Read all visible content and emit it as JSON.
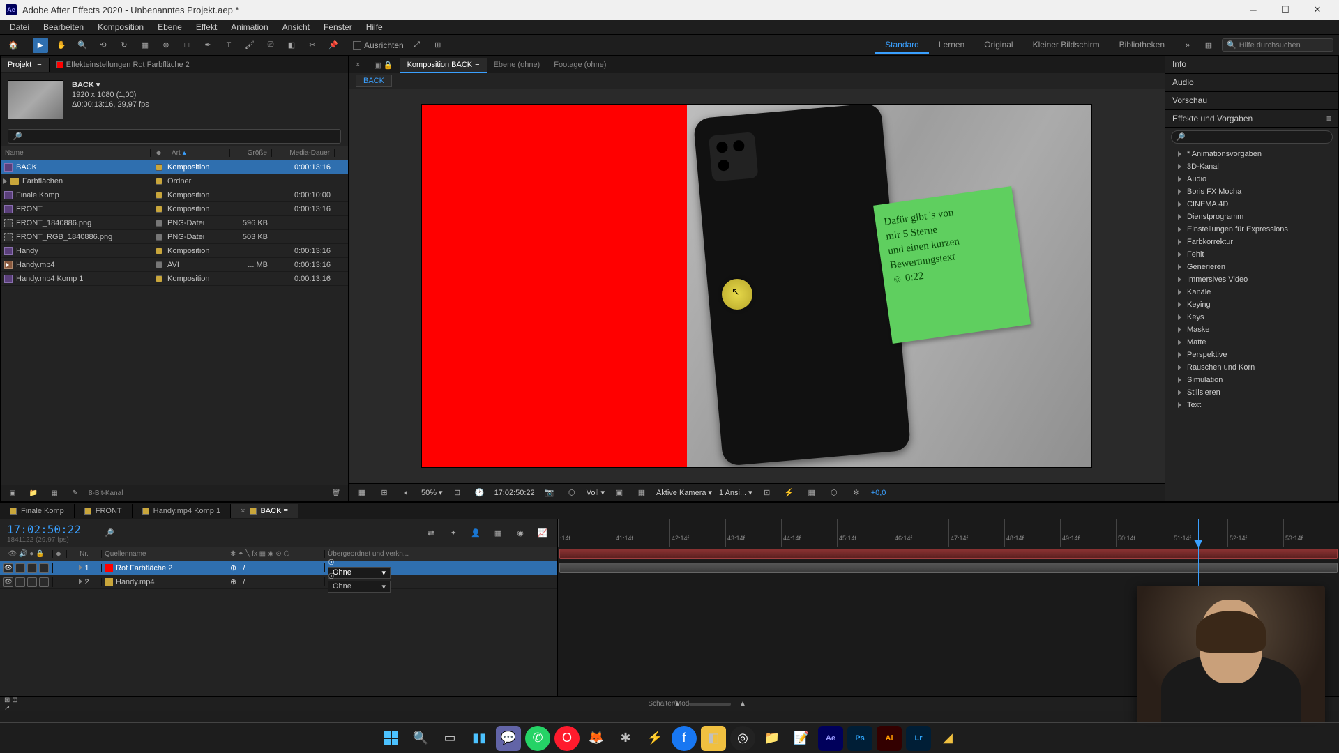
{
  "app": {
    "title": "Adobe After Effects 2020 - Unbenanntes Projekt.aep *"
  },
  "menu": [
    "Datei",
    "Bearbeiten",
    "Komposition",
    "Ebene",
    "Effekt",
    "Animation",
    "Ansicht",
    "Fenster",
    "Hilfe"
  ],
  "toolbar": {
    "align_label": "Ausrichten",
    "workspaces": [
      "Standard",
      "Lernen",
      "Original",
      "Kleiner Bildschirm",
      "Bibliotheken"
    ],
    "active_workspace": "Standard",
    "search_placeholder": "Hilfe durchsuchen"
  },
  "project": {
    "tab_project": "Projekt",
    "tab_effect": "Effekteinstellungen Rot Farbfläche 2",
    "preview_name": "BACK",
    "preview_dims": "1920 x 1080 (1,00)",
    "preview_dur": "Δ0:00:13:16, 29,97 fps",
    "headers": {
      "name": "Name",
      "label": "",
      "art": "Art",
      "size": "Größe",
      "dur": "Media-Dauer"
    },
    "rows": [
      {
        "name": "BACK",
        "icon": "comp",
        "label": "#c9a63b",
        "art": "Komposition",
        "size": "",
        "dur": "0:00:13:16",
        "selected": true
      },
      {
        "name": "Farbflächen",
        "icon": "folder",
        "label": "#c9a63b",
        "art": "Ordner",
        "size": "",
        "dur": "",
        "reveal": true
      },
      {
        "name": "Finale Komp",
        "icon": "comp",
        "label": "#c9a63b",
        "art": "Komposition",
        "size": "",
        "dur": "0:00:10:00"
      },
      {
        "name": "FRONT",
        "icon": "comp",
        "label": "#c9a63b",
        "art": "Komposition",
        "size": "",
        "dur": "0:00:13:16"
      },
      {
        "name": "FRONT_1840886.png",
        "icon": "png",
        "label": "#777",
        "art": "PNG-Datei",
        "size": "596 KB",
        "dur": ""
      },
      {
        "name": "FRONT_RGB_1840886.png",
        "icon": "png",
        "label": "#777",
        "art": "PNG-Datei",
        "size": "503 KB",
        "dur": ""
      },
      {
        "name": "Handy",
        "icon": "comp",
        "label": "#c9a63b",
        "art": "Komposition",
        "size": "",
        "dur": "0:00:13:16"
      },
      {
        "name": "Handy.mp4",
        "icon": "avi",
        "label": "#777",
        "art": "AVI",
        "size": "... MB",
        "dur": "0:00:13:16"
      },
      {
        "name": "Handy.mp4 Komp 1",
        "icon": "comp",
        "label": "#c9a63b",
        "art": "Komposition",
        "size": "",
        "dur": "0:00:13:16"
      }
    ],
    "footer_bpc": "8-Bit-Kanal"
  },
  "comp": {
    "tabs": {
      "main": "Komposition BACK",
      "layer": "Ebene (ohne)",
      "footage": "Footage (ohne)"
    },
    "crumb": "BACK",
    "sticky_text": "Dafür gibt 's von\nmir 5 Sterne\nund einen kurzen\nBewertungstext\n☺ 0:22",
    "footer": {
      "zoom": "50%",
      "tc": "17:02:50:22",
      "res": "Voll",
      "cam": "Aktive Kamera",
      "views": "1 Ansi...",
      "exp": "+0,0"
    }
  },
  "right": {
    "panels": [
      "Info",
      "Audio",
      "Vorschau"
    ],
    "effects_title": "Effekte und Vorgaben",
    "fx": [
      "* Animationsvorgaben",
      "3D-Kanal",
      "Audio",
      "Boris FX Mocha",
      "CINEMA 4D",
      "Dienstprogramm",
      "Einstellungen für Expressions",
      "Farbkorrektur",
      "Fehlt",
      "Generieren",
      "Immersives Video",
      "Kanäle",
      "Keying",
      "Keys",
      "Maske",
      "Matte",
      "Perspektive",
      "Rauschen und Korn",
      "Simulation",
      "Stilisieren",
      "Text"
    ]
  },
  "timeline": {
    "tabs": [
      {
        "label": "Finale Komp",
        "color": "#c9a63b"
      },
      {
        "label": "FRONT",
        "color": "#c9a63b"
      },
      {
        "label": "Handy.mp4 Komp 1",
        "color": "#c9a63b"
      },
      {
        "label": "BACK",
        "color": "#c9a63b",
        "active": true
      }
    ],
    "tc": "17:02:50:22",
    "tc_sub": "1841122 (29,97 fps)",
    "head": {
      "nr": "Nr.",
      "name": "Quellenname",
      "parent": "Übergeordnet und verkn..."
    },
    "layers": [
      {
        "num": "1",
        "name": "Rot Farbfläche 2",
        "color": "#ff0000",
        "parent": "Ohne",
        "selected": true,
        "clip": "red"
      },
      {
        "num": "2",
        "name": "Handy.mp4",
        "color": "#c9a63b",
        "parent": "Ohne",
        "clip": "grey"
      }
    ],
    "ticks": [
      ":14f",
      "41:14f",
      "42:14f",
      "43:14f",
      "44:14f",
      "45:14f",
      "46:14f",
      "47:14f",
      "48:14f",
      "49:14f",
      "50:14f",
      "51:14f",
      "52:14f",
      "53:14f"
    ],
    "footer": "Schalter/Modi"
  }
}
